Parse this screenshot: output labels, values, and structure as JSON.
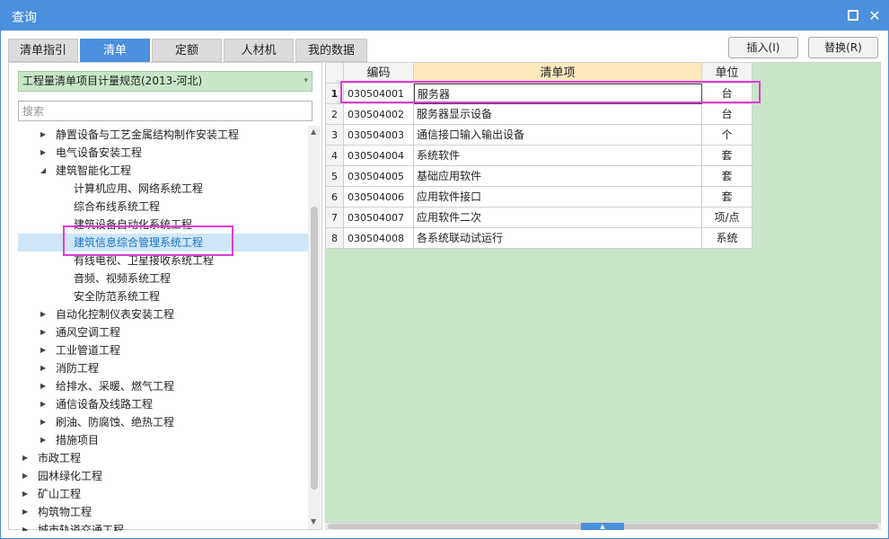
{
  "window": {
    "title": "查询"
  },
  "titlebar": {
    "maximize_icon": "maximize-icon",
    "close_glyph": "✕"
  },
  "tabs": [
    {
      "label": "清单指引",
      "active": false
    },
    {
      "label": "清单",
      "active": true
    },
    {
      "label": "定额",
      "active": false
    },
    {
      "label": "人材机",
      "active": false
    },
    {
      "label": "我的数据",
      "active": false
    }
  ],
  "actions": {
    "insert_label": "插入(I)",
    "replace_label": "替换(R)"
  },
  "spec": {
    "selected": "工程量清单项目计量规范(2013-河北)",
    "arrow": "▾"
  },
  "search": {
    "placeholder": "搜索"
  },
  "tree": {
    "nodes": [
      {
        "label": "静置设备与工艺金属结构制作安装工程",
        "toggle": "▶"
      },
      {
        "label": "电气设备安装工程",
        "toggle": "▶"
      },
      {
        "label": "建筑智能化工程",
        "toggle": "◢"
      },
      {
        "label": "计算机应用、网络系统工程",
        "toggle": ""
      },
      {
        "label": "综合布线系统工程",
        "toggle": ""
      },
      {
        "label": "建筑设备自动化系统工程",
        "toggle": ""
      },
      {
        "label": "建筑信息综合管理系统工程",
        "toggle": "",
        "selected": true
      },
      {
        "label": "有线电视、卫星接收系统工程",
        "toggle": ""
      },
      {
        "label": "音频、视频系统工程",
        "toggle": ""
      },
      {
        "label": "安全防范系统工程",
        "toggle": ""
      },
      {
        "label": "自动化控制仪表安装工程",
        "toggle": "▶"
      },
      {
        "label": "通风空调工程",
        "toggle": "▶"
      },
      {
        "label": "工业管道工程",
        "toggle": "▶"
      },
      {
        "label": "消防工程",
        "toggle": "▶"
      },
      {
        "label": "给排水、采暖、燃气工程",
        "toggle": "▶"
      },
      {
        "label": "通信设备及线路工程",
        "toggle": "▶"
      },
      {
        "label": "刷油、防腐蚀、绝热工程",
        "toggle": "▶"
      },
      {
        "label": "措施项目",
        "toggle": "▶"
      },
      {
        "label": "市政工程",
        "toggle": "▶"
      },
      {
        "label": "园林绿化工程",
        "toggle": "▶"
      },
      {
        "label": "矿山工程",
        "toggle": "▶"
      },
      {
        "label": "构筑物工程",
        "toggle": "▶"
      },
      {
        "label": "城市轨道交通工程",
        "toggle": "▶"
      }
    ]
  },
  "scroll": {
    "up": "▲",
    "down": "▼",
    "grip": "▲"
  },
  "table": {
    "headers": {
      "code": "编码",
      "name": "清单项",
      "unit": "单位"
    },
    "rows": [
      {
        "index": "1",
        "code": "030504001",
        "name": "服务器",
        "unit": "台"
      },
      {
        "index": "2",
        "code": "030504002",
        "name": "服务器显示设备",
        "unit": "台"
      },
      {
        "index": "3",
        "code": "030504003",
        "name": "通信接口输入输出设备",
        "unit": "个"
      },
      {
        "index": "4",
        "code": "030504004",
        "name": "系统软件",
        "unit": "套"
      },
      {
        "index": "5",
        "code": "030504005",
        "name": "基础应用软件",
        "unit": "套"
      },
      {
        "index": "6",
        "code": "030504006",
        "name": "应用软件接口",
        "unit": "套"
      },
      {
        "index": "7",
        "code": "030504007",
        "name": "应用软件二次",
        "unit": "项/点"
      },
      {
        "index": "8",
        "code": "030504008",
        "name": "各系统联动试运行",
        "unit": "系统"
      }
    ]
  },
  "colors": {
    "accent": "#4b90dd",
    "grid_bg": "#c9e6c9",
    "highlight": "#e23cd9",
    "selected_text": "#1a73c8"
  }
}
